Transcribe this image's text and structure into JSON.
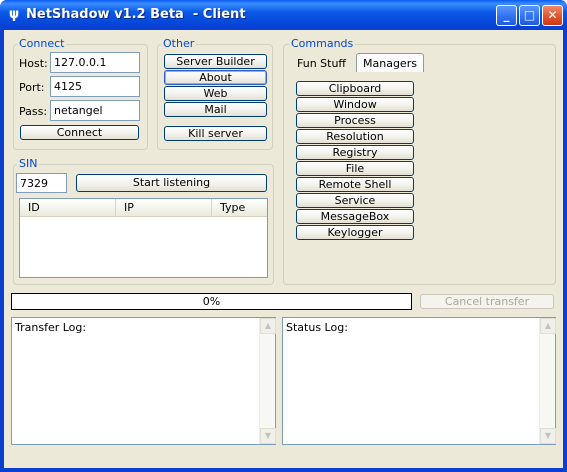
{
  "window": {
    "title": "NetShadow v1.2 Beta  - Client",
    "app_icon": "netshadow-app-icon",
    "controls": {
      "minimize": "_",
      "maximize": "□",
      "close": "✕"
    }
  },
  "connect": {
    "group_label": "Connect",
    "host_label": "Host:",
    "host_value": "127.0.0.1",
    "port_label": "Port:",
    "port_value": "4125",
    "pass_label": "Pass:",
    "pass_value": "netangel",
    "connect_button": "Connect"
  },
  "other": {
    "group_label": "Other",
    "buttons": [
      "Server Builder",
      "About",
      "Web",
      "Mail"
    ],
    "kill_button": "Kill server"
  },
  "commands": {
    "group_label": "Commands",
    "tabs": [
      "Fun Stuff",
      "Managers"
    ],
    "selected_tab": "Managers",
    "buttons": [
      "Clipboard",
      "Window",
      "Process",
      "Resolution",
      "Registry",
      "File",
      "Remote Shell",
      "Service",
      "MessageBox",
      "Keylogger"
    ]
  },
  "sin": {
    "group_label": "SIN",
    "port_value": "7329",
    "start_button": "Start listening",
    "columns": [
      "ID",
      "IP",
      "Type"
    ]
  },
  "transfer": {
    "progress_text": "0%",
    "progress_value": 0,
    "cancel_button": "Cancel transfer"
  },
  "logs": {
    "transfer_log": "Transfer Log:",
    "status_log": "Status Log:"
  },
  "colors": {
    "titlebar": "#0a5ae8",
    "client_bg": "#ece9d8",
    "group_label": "#0046d5"
  }
}
